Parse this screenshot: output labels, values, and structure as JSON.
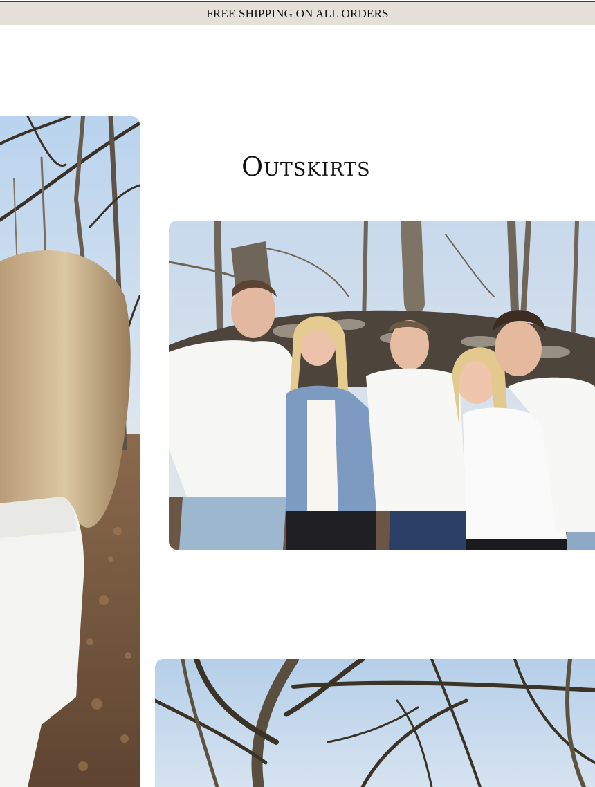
{
  "announcement": {
    "text": "FREE SHIPPING ON ALL ORDERS"
  },
  "section": {
    "title": "Outskirts"
  },
  "colors": {
    "announcement_bg": "#e6e1d8",
    "text": "#111111",
    "page_bg": "#ffffff"
  }
}
